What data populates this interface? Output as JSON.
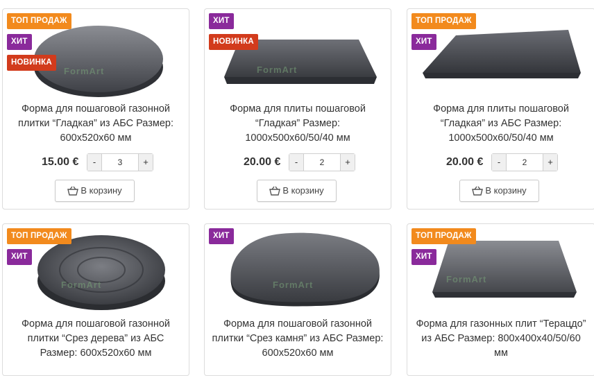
{
  "badges": {
    "top": "ТОП ПРОДАЖ",
    "hit": "ХИТ",
    "new": "НОВИНКА"
  },
  "watermark": "FormArt",
  "cart_label": "В корзину",
  "products": [
    {
      "title": "Форма для пошаговой газонной плитки “Гладкая” из АБС Размер: 600х520х60 мм",
      "price": "15.00 €",
      "qty": "3"
    },
    {
      "title": "Форма для плиты пошаговой “Гладкая” Размер: 1000х500х60/50/40 мм",
      "price": "20.00 €",
      "qty": "2"
    },
    {
      "title": "Форма для плиты пошаговой “Гладкая” из АБС Размер: 1000х500х60/50/40 мм",
      "price": "20.00 €",
      "qty": "2"
    },
    {
      "title": "Форма для пошаговой газонной плитки “Срез дерева” из АБС Размер: 600х520х60 мм"
    },
    {
      "title": "Форма для пошаговой газонной плитки “Срез камня” из АБС Размер: 600х520х60 мм"
    },
    {
      "title": "Форма для газонных плит “Терацдо” из АБС Размер: 800х400х40/50/60 мм"
    }
  ],
  "qty_controls": {
    "minus": "-",
    "plus": "+"
  }
}
